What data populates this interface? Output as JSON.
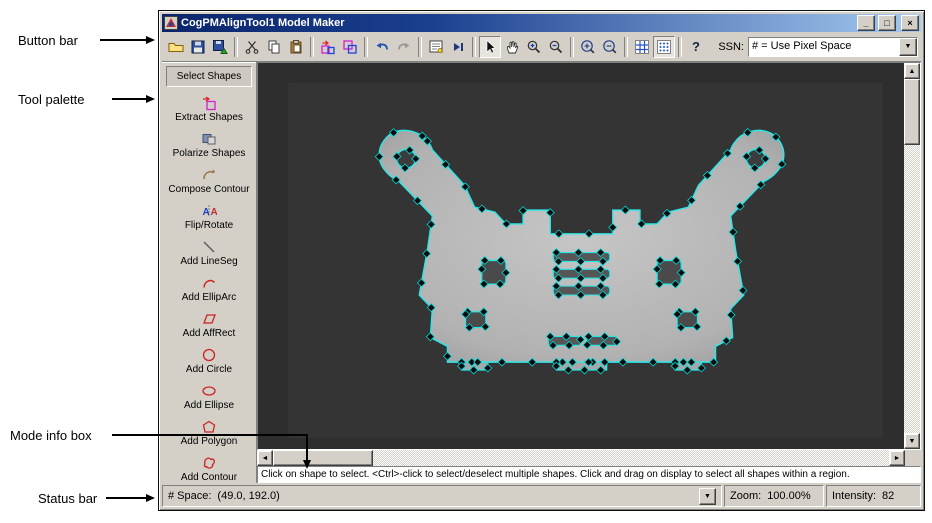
{
  "annotations": {
    "button_bar_label": "Button bar",
    "tool_palette_label": "Tool palette",
    "mode_info_label": "Mode info box",
    "status_bar_label": "Status bar"
  },
  "window": {
    "title": "CogPMAlignTool1 Model Maker",
    "controls": [
      "minimize",
      "maximize",
      "close"
    ]
  },
  "toolbar": {
    "buttons": [
      "open",
      "save",
      "save-image",
      "cut",
      "copy",
      "paste",
      "extract-train",
      "train",
      "undo",
      "redo",
      "properties",
      "run-once",
      "select-pointer",
      "pan-hand",
      "zoom-in",
      "zoom-out",
      "zoom-in-centered",
      "zoom-out-centered",
      "grid-axes",
      "grid-dots",
      "help"
    ],
    "ssn_label": "SSN:",
    "ssn_value": "# = Use Pixel Space"
  },
  "palette": {
    "items": [
      {
        "label": "Select Shapes",
        "icon": "select-shapes"
      },
      {
        "label": "Extract Shapes",
        "icon": "extract-shapes"
      },
      {
        "label": "Polarize Shapes",
        "icon": "polarize-shapes"
      },
      {
        "label": "Compose Contour",
        "icon": "compose-contour"
      },
      {
        "label": "Flip/Rotate",
        "icon": "flip-rotate"
      },
      {
        "label": "Add LineSeg",
        "icon": "add-lineseg"
      },
      {
        "label": "Add EllipArc",
        "icon": "add-elliparc"
      },
      {
        "label": "Add AffRect",
        "icon": "add-affrect"
      },
      {
        "label": "Add Circle",
        "icon": "add-circle"
      },
      {
        "label": "Add Ellipse",
        "icon": "add-ellipse"
      },
      {
        "label": "Add Polygon",
        "icon": "add-polygon"
      },
      {
        "label": "Add Contour",
        "icon": "add-contour"
      }
    ]
  },
  "mode_info": {
    "text": "Click on shape to select. <Ctrl>-click to select/deselect multiple shapes. Click and drag on display to select all shapes within a region."
  },
  "status": {
    "space_label": "# Space:",
    "space_value": "(49.0, 192.0)",
    "zoom_label": "Zoom:",
    "zoom_value": "100.00%",
    "intensity_label": "Intensity:",
    "intensity_value": "82"
  },
  "colors": {
    "chrome": "#d4d0c8",
    "titlebar_start": "#0a246a",
    "titlebar_end": "#a6caf0",
    "contour": "#2ae8e8",
    "display_bg": "#2a2a2a"
  }
}
